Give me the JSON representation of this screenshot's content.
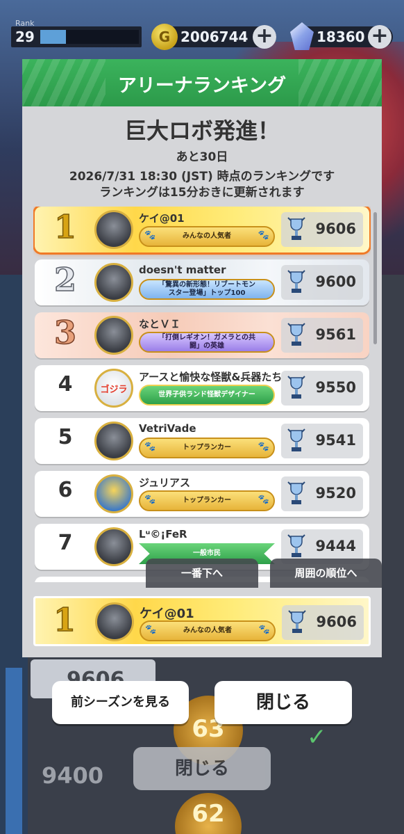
{
  "hud": {
    "rank_label": "Rank",
    "rank_value": "29",
    "rank_progress": 0.26,
    "coin_icon": "G",
    "coins": "2006744",
    "gems": "18360",
    "plus": "+"
  },
  "modal": {
    "title": "アリーナランキング",
    "event_name": "巨大ロボ発進！",
    "days_left": "あと30日",
    "info_line1": "2026/7/31 18:30 (JST) 時点のランキングです",
    "info_line2": "ランキングは15分おきに更新されます"
  },
  "rows": [
    {
      "rank": "1",
      "name": "ケイ@01",
      "title": "みんなの人気者",
      "score": "9606"
    },
    {
      "rank": "2",
      "name": "doesn't matter",
      "title": "「驚異の新形態！リブートモンスター登場」トップ100",
      "score": "9600"
    },
    {
      "rank": "3",
      "name": "なとＶＩ",
      "title": "「打倒レギオン！ガメラとの共闘」の英雄",
      "score": "9561"
    },
    {
      "rank": "4",
      "name": "アースと愉快な怪獣&兵器たち",
      "title": "世界子供ランド怪獣デザイナー",
      "score": "9550"
    },
    {
      "rank": "5",
      "name": "VetriVade",
      "title": "トップランカー",
      "score": "9541"
    },
    {
      "rank": "6",
      "name": "ジュリアス",
      "title": "トップランカー",
      "score": "9520"
    },
    {
      "rank": "7",
      "name": "Lᵘ©¡FeR",
      "title": "一般市民",
      "score": "9444"
    }
  ],
  "avatar_text": {
    "row4": "ゴジラ"
  },
  "fab": {
    "to_bottom": "一番下へ",
    "around": "周囲の順位へ"
  },
  "self": {
    "rank": "1",
    "name": "ケイ@01",
    "title": "みんなの人気者",
    "score": "9606"
  },
  "buttons": {
    "prev_season": "前シーズンを見る",
    "close": "閉じる"
  },
  "background": {
    "card_score": "9606",
    "low_score": "9400",
    "badge1": "63",
    "badge2": "62",
    "close": "閉じる"
  },
  "icons": {
    "paw": "paw-icon",
    "trophy": "trophy-icon",
    "coin": "coin-icon",
    "gem": "gem-icon"
  },
  "colors": {
    "header_green": "#3bb35c",
    "gold": "#ffd84a",
    "highlight_border": "#f07a26"
  }
}
